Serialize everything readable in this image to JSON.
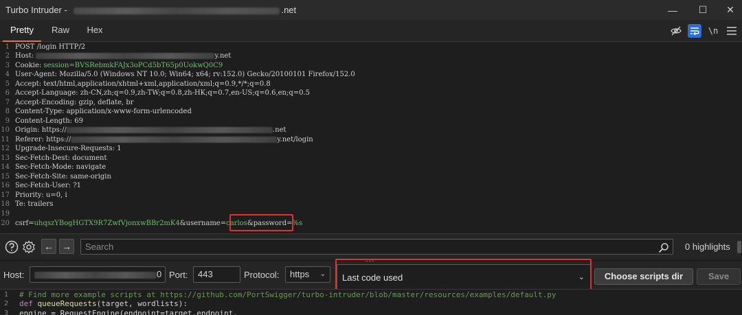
{
  "window": {
    "title_prefix": "Turbo Intruder - ",
    "title_suffix": ".net",
    "minimize": "—",
    "maximize": "☐",
    "close": "✕"
  },
  "tabs": [
    {
      "label": "Pretty",
      "active": true
    },
    {
      "label": "Raw",
      "active": false
    },
    {
      "label": "Hex",
      "active": false
    }
  ],
  "toolbar": {
    "newline_label": "\\n",
    "accent_color": "#2d6dd1"
  },
  "request": {
    "lines": [
      {
        "n": "1",
        "key": "POST /login HTTP/2",
        "value": ""
      },
      {
        "n": "2",
        "key": "Host: ",
        "value": "y.net"
      },
      {
        "n": "3",
        "key": "Cookie: ",
        "value": "session=BVSRebmkFAJx3oPCd5bT65p0UokwQ0C9"
      },
      {
        "n": "4",
        "key": "User-Agent: ",
        "value": "Mozilla/5.0 (Windows NT 10.0; Win64; x64; rv:152.0) Gecko/20100101 Firefox/152.0"
      },
      {
        "n": "5",
        "key": "Accept: ",
        "value": "text/html,application/xhtml+xml,application/xml;q=0.9,*/*;q=0.8"
      },
      {
        "n": "6",
        "key": "Accept-Language: ",
        "value": "zh-CN,zh;q=0.9,zh-TW;q=0.8,zh-HK;q=0.7,en-US;q=0.6,en;q=0.5"
      },
      {
        "n": "7",
        "key": "Accept-Encoding: ",
        "value": "gzip, deflate, br"
      },
      {
        "n": "8",
        "key": "Content-Type: ",
        "value": "application/x-www-form-urlencoded"
      },
      {
        "n": "9",
        "key": "Content-Length: ",
        "value": "69"
      },
      {
        "n": "10",
        "key": "Origin: ",
        "value": "https://"
      },
      {
        "n": "11",
        "key": "Referer: ",
        "value": "https://"
      },
      {
        "n": "12",
        "key": "Upgrade-Insecure-Requests: ",
        "value": "1"
      },
      {
        "n": "13",
        "key": "Sec-Fetch-Dest: ",
        "value": "document"
      },
      {
        "n": "14",
        "key": "Sec-Fetch-Mode: ",
        "value": "navigate"
      },
      {
        "n": "15",
        "key": "Sec-Fetch-Site: ",
        "value": "same-origin"
      },
      {
        "n": "16",
        "key": "Sec-Fetch-User: ",
        "value": "?1"
      },
      {
        "n": "17",
        "key": "Priority: ",
        "value": "u=0, i"
      },
      {
        "n": "18",
        "key": "Te: ",
        "value": "trailers"
      },
      {
        "n": "19",
        "key": "",
        "value": ""
      },
      {
        "n": "20",
        "key": "",
        "value": ""
      }
    ],
    "origin_suffix": ".net",
    "referer_suffix": "y.net/login",
    "body": {
      "csrf_key": "csrf=",
      "csrf_value": "uhqszYBogHGTX9R7ZwfVjonxwBBr2mK4",
      "user_key": "&username=",
      "user_value": "carlos",
      "pass_key": "&password=",
      "pass_value": "%s"
    }
  },
  "search": {
    "placeholder": "Search",
    "highlights": "0 highlights",
    "prev": "←",
    "next": "→"
  },
  "config": {
    "host_label": "Host:",
    "host_value_tail": "0",
    "port_label": "Port:",
    "port_value": "443",
    "protocol_label": "Protocol:",
    "protocol_value": "https",
    "script_select": "Last code used",
    "choose_scripts_button": "Choose scripts dir",
    "save_button": "Save"
  },
  "script": {
    "lines": [
      {
        "n": "1",
        "text": "# Find more example scripts at https://github.com/PortSwigger/turbo-intruder/blob/master/resources/examples/default.py"
      },
      {
        "n": "2",
        "kw": "def ",
        "fn": "queueRequests",
        "rest": "(target, wordlists):"
      },
      {
        "n": "3",
        "text": "    engine = RequestEngine(endpoint=target.endpoint,"
      }
    ]
  },
  "colors": {
    "highlight_box": "#e03030",
    "active_tab_underline": "#e8743b",
    "value_green": "#6fc36f"
  }
}
